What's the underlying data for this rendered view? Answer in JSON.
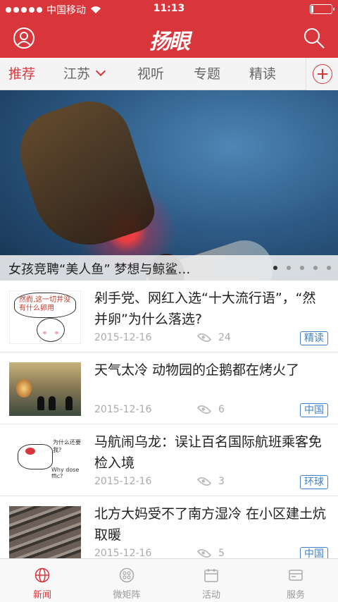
{
  "status_bar": {
    "carrier": "中国移动",
    "time": "11:13"
  },
  "header": {
    "title": "扬眼"
  },
  "tabs": [
    {
      "label": "推荐"
    },
    {
      "label": "江苏"
    },
    {
      "label": "视听"
    },
    {
      "label": "专题"
    },
    {
      "label": "精读"
    }
  ],
  "banner": {
    "caption": "女孩竞聘“美人鱼” 梦想与鲸鲨…",
    "pages": 5,
    "current_page": 1
  },
  "thumb_text": {
    "bubble": "然而,这一切并没有什么卵用",
    "question": "为什么还要我?",
    "why": "Why dose ffic?"
  },
  "news": [
    {
      "title": "剁手党、网红入选“十大流行语”，“然并卵”为什么落选?",
      "date": "2015-12-16",
      "views": "24",
      "tag": "精读"
    },
    {
      "title": "天气太冷 动物园的企鹅都在烤火了",
      "date": "2015-12-16",
      "views": "6",
      "tag": "中国"
    },
    {
      "title": "马航闹乌龙：误让百名国际航班乘客免检入境",
      "date": "2015-12-16",
      "views": "3",
      "tag": "环球"
    },
    {
      "title": "北方大妈受不了南方湿冷 在小区建土炕取暖",
      "date": "2015-12-16",
      "views": "5",
      "tag": "中国"
    }
  ],
  "bottom_nav": [
    {
      "label": "新闻",
      "icon": "globe-icon"
    },
    {
      "label": "微矩阵",
      "icon": "grid-icon"
    },
    {
      "label": "活动",
      "icon": "calendar-icon"
    },
    {
      "label": "服务",
      "icon": "card-icon"
    }
  ],
  "colors": {
    "brand": "#d9363b",
    "tag": "#3f7fc4"
  }
}
